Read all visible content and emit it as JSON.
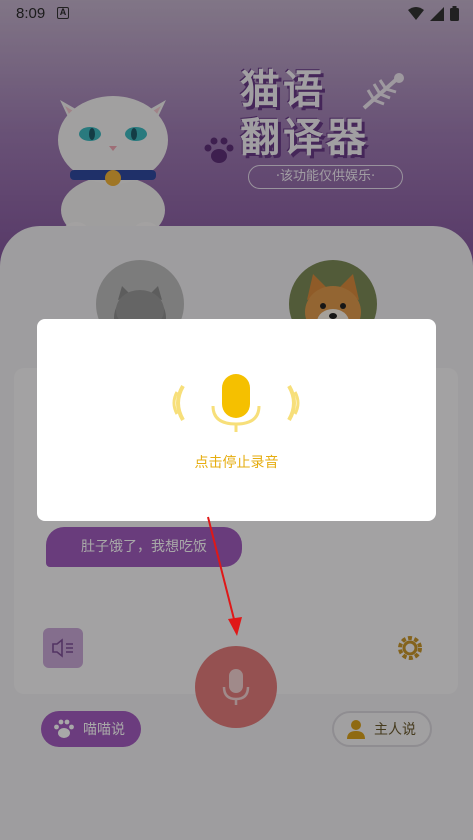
{
  "status_bar": {
    "time": "8:09",
    "notification_icon": "A"
  },
  "header": {
    "title_line1": "猫语",
    "title_line2": "翻译器",
    "subtitle": "·该功能仅供娱乐·"
  },
  "chat": {
    "message": "肚子饿了，我想吃饭"
  },
  "buttons": {
    "meow_label": "喵喵说",
    "owner_label": "主人说"
  },
  "modal": {
    "hint": "点击停止录音"
  },
  "colors": {
    "accent_purple": "#a35bbf",
    "record_yellow": "#f5c000",
    "mic_red": "#e37b7c"
  }
}
